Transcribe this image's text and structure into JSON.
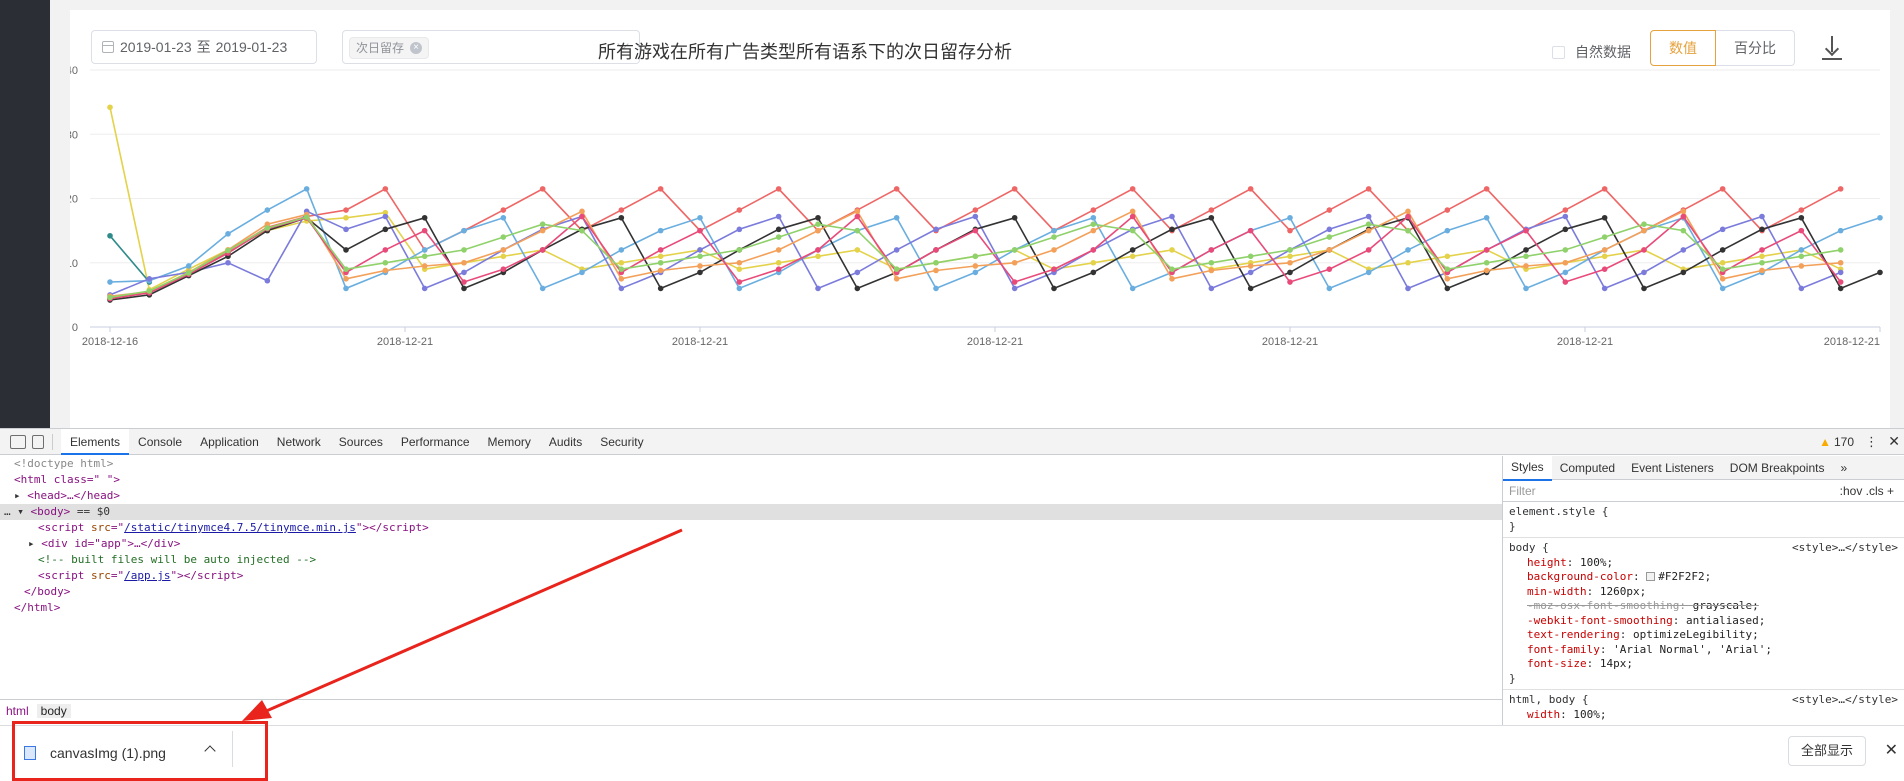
{
  "filters": {
    "date_range": {
      "start": "2019-01-23",
      "separator": "至",
      "end": "2019-01-23"
    },
    "metric_tag": "次日留存"
  },
  "title": "所有游戏在所有广告类型所有语系下的次日留存分析",
  "natural_data_label": "自然数据",
  "toggle": {
    "value": "数值",
    "percent": "百分比"
  },
  "chart_data": {
    "type": "line",
    "ylim": [
      0,
      40
    ],
    "yticks": [
      0,
      10,
      20,
      30,
      40
    ],
    "xtick_labels": [
      "2018-12-16",
      "2018-12-21",
      "2018-12-21",
      "2018-12-21",
      "2018-12-21",
      "2018-12-21",
      "2018-12-21"
    ],
    "grid": "horizontal",
    "series": [
      {
        "color": "#ee6666",
        "values": [
          4.5,
          5.5,
          8.3,
          11.8,
          15.5,
          17.2,
          18.2,
          21.5,
          12,
          15,
          18.2,
          21.5,
          15,
          18.2,
          21.5,
          15,
          18.2,
          21.5,
          15,
          18.2,
          21.5,
          15,
          18.2,
          21.5,
          15,
          18.2,
          21.5,
          15,
          18.2,
          21.5,
          15,
          18.2,
          21.5,
          15,
          18.2,
          21.5,
          15,
          18.2,
          21.5,
          15,
          18.2,
          21.5,
          15,
          18.2,
          21.5
        ]
      },
      {
        "color": "#e3d24a",
        "values": [
          34.2,
          5.8,
          9,
          12,
          15,
          16.5,
          17,
          17.8,
          9,
          10,
          11,
          12,
          9,
          10,
          11,
          12,
          9,
          10,
          11,
          12,
          9,
          10,
          11,
          12,
          9,
          10,
          11,
          12,
          9,
          10,
          11,
          12,
          9,
          10,
          11,
          12,
          9,
          10,
          11,
          12,
          9,
          10,
          11,
          12,
          9
        ]
      },
      {
        "color": "#2f8a8a",
        "values": [
          14.2,
          7
        ]
      },
      {
        "color": "#6aaee0",
        "values": [
          7,
          7.2,
          9.5,
          14.5,
          18.2,
          21.5,
          6,
          8.5,
          12,
          15,
          17,
          6,
          8.5,
          12,
          15,
          17,
          6,
          8.5,
          12,
          15,
          17,
          6,
          8.5,
          12,
          15,
          17,
          6,
          8.5,
          12,
          15,
          17,
          6,
          8.5,
          12,
          15,
          17,
          6,
          8.5,
          12,
          15,
          17,
          6,
          8.5,
          12,
          15,
          17
        ]
      },
      {
        "color": "#7b7bdc",
        "values": [
          5,
          7.5,
          8.5,
          10,
          7.2,
          18,
          15.2,
          17.2,
          6,
          8.5,
          12,
          15.2,
          17.2,
          6,
          8.5,
          12,
          15.2,
          17.2,
          6,
          8.5,
          12,
          15.2,
          17.2,
          6,
          8.5,
          12,
          15.2,
          17.2,
          6,
          8.5,
          12,
          15.2,
          17.2,
          6,
          8.5,
          12,
          15.2,
          17.2,
          6,
          8.5,
          12,
          15.2,
          17.2,
          6,
          8.5
        ]
      },
      {
        "color": "#333333",
        "values": [
          4.2,
          5,
          8,
          11,
          15,
          17,
          12,
          15.2,
          17,
          6,
          8.5,
          12,
          15.2,
          17,
          6,
          8.5,
          12,
          15.2,
          17,
          6,
          8.5,
          12,
          15.2,
          17,
          6,
          8.5,
          12,
          15.2,
          17,
          6,
          8.5,
          12,
          15.2,
          17,
          6,
          8.5,
          12,
          15.2,
          17,
          6,
          8.5,
          12,
          15.2,
          17,
          6,
          8.5
        ]
      },
      {
        "color": "#f3a15a",
        "values": [
          4.8,
          5.5,
          8.5,
          12,
          16,
          17.5,
          7.5,
          8.8,
          9.5,
          10,
          12,
          15,
          18,
          7.5,
          8.8,
          9.5,
          10,
          12,
          15,
          18,
          7.5,
          8.8,
          9.5,
          10,
          12,
          15,
          18,
          7.5,
          8.8,
          9.5,
          10,
          12,
          15,
          18,
          7.5,
          8.8,
          9.5,
          10,
          12,
          15,
          18,
          7.5,
          8.8,
          9.5,
          10
        ]
      },
      {
        "color": "#e84a7a",
        "values": [
          4.4,
          5.3,
          8.2,
          11.5,
          15.3,
          17,
          8.5,
          12,
          15,
          7,
          9,
          12,
          17.2,
          8.5,
          12,
          15,
          7,
          9,
          12,
          17.2,
          8.5,
          12,
          15,
          7,
          9,
          12,
          17.2,
          8.5,
          12,
          15,
          7,
          9,
          12,
          17.2,
          8.5,
          12,
          15,
          7,
          9,
          12,
          17.2,
          8.5,
          12,
          15,
          7
        ]
      },
      {
        "color": "#8fd16a",
        "values": [
          4.6,
          5.6,
          8.4,
          11.9,
          15.4,
          17.1,
          9,
          10,
          11,
          12,
          14,
          16,
          15,
          9,
          10,
          11,
          12,
          14,
          16,
          15,
          9,
          10,
          11,
          12,
          14,
          16,
          15,
          9,
          10,
          11,
          12,
          14,
          16,
          15,
          9,
          10,
          11,
          12,
          14,
          16,
          15,
          9,
          10,
          11,
          12
        ]
      }
    ]
  },
  "devtools": {
    "tabs": [
      "Elements",
      "Console",
      "Application",
      "Network",
      "Sources",
      "Performance",
      "Memory",
      "Audits",
      "Security"
    ],
    "warning_count": "170",
    "dom_lines": {
      "doctype": "<!doctype html>",
      "html_open": "<html class=\" \">",
      "head": "<head>…</head>",
      "body_open": "<body>",
      "body_marker": "== $0",
      "script1_src": "/static/tinymce4.7.5/tinymce.min.js",
      "app_div": "<div id=\"app\">…</div>",
      "comment": "<!-- built files will be auto injected -->",
      "script2_src": "/app.js",
      "body_close": "</body>",
      "html_close": "</html>"
    },
    "breadcrumb": [
      "html",
      "body"
    ],
    "styles_tabs": [
      "Styles",
      "Computed",
      "Event Listeners",
      "DOM Breakpoints",
      "»"
    ],
    "filter_placeholder": "Filter",
    "filter_options": ":hov .cls +",
    "style_source": "<style>…</style>",
    "rules": {
      "element_style": "element.style {",
      "body_selector": "body {",
      "body_props": [
        {
          "name": "height",
          "value": "100%;"
        },
        {
          "name": "background-color",
          "value": "#F2F2F2;"
        },
        {
          "name": "min-width",
          "value": "1260px;"
        },
        {
          "name": "-moz-osx-font-smoothing",
          "value": "grayscale;"
        },
        {
          "name": "-webkit-font-smoothing",
          "value": "antialiased;"
        },
        {
          "name": "text-rendering",
          "value": "optimizeLegibility;"
        },
        {
          "name": "font-family",
          "value": "'Arial Normal', 'Arial';"
        },
        {
          "name": "font-size",
          "value": "14px;"
        }
      ],
      "html_body_selector": "html, body {",
      "html_body_prop": {
        "name": "width",
        "value": "100%;"
      }
    }
  },
  "downloads": {
    "filename": "canvasImg (1).png",
    "show_all": "全部显示"
  },
  "annotation_color": "#e8241c"
}
